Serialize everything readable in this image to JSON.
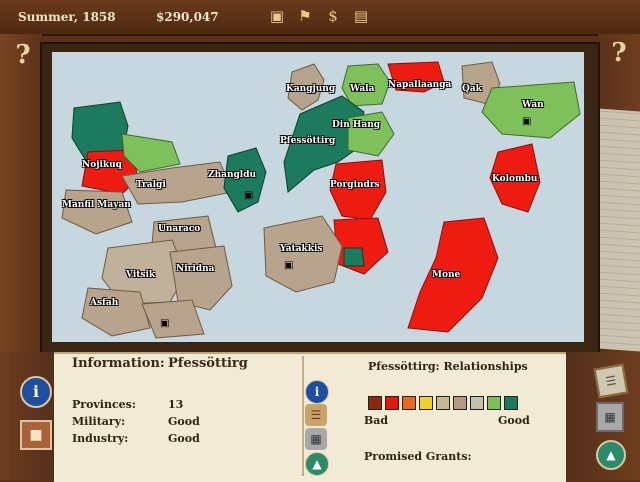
{
  "header": {
    "season": "Summer, 1858",
    "money": "$290,047"
  },
  "toolbar_icons": [
    "advisor-icon",
    "parliament-icon",
    "finance-icon",
    "factory-icon"
  ],
  "corners": {
    "left": "?",
    "right": "?"
  },
  "map": {
    "provinces": [
      {
        "name": "Kangjung"
      },
      {
        "name": "Wala"
      },
      {
        "name": "Napallaanga"
      },
      {
        "name": "Qak"
      },
      {
        "name": "Wan"
      },
      {
        "name": "Pfessöttirg"
      },
      {
        "name": "Din Hang"
      },
      {
        "name": "Nojikuq"
      },
      {
        "name": "Tralgi"
      },
      {
        "name": "Zhangldu"
      },
      {
        "name": "Porgindrs"
      },
      {
        "name": "Kolombu"
      },
      {
        "name": "Manfil Mayan"
      },
      {
        "name": "Unaraco"
      },
      {
        "name": "Yatakkis"
      },
      {
        "name": "Vitsik"
      },
      {
        "name": "Niridna"
      },
      {
        "name": "Mone"
      },
      {
        "name": "Asfah"
      }
    ]
  },
  "info": {
    "title": "Information:",
    "name": "Pfessöttirg",
    "rows": [
      {
        "label": "Provinces:",
        "value": "13"
      },
      {
        "label": "Military:",
        "value": "Good"
      },
      {
        "label": "Industry:",
        "value": "Good"
      }
    ]
  },
  "relationships": {
    "title": "Pfessöttirg: Relationships",
    "scale_colors": [
      "#8b2a0a",
      "#e21a0e",
      "#e86a18",
      "#f0d22a",
      "#c8b890",
      "#b39a80",
      "#c4c0ae",
      "#7fbf58",
      "#1a7a5a"
    ],
    "bad_label": "Bad",
    "good_label": "Good",
    "grants_label": "Promised Grants:"
  },
  "colors": {
    "sea": "#c6d7df",
    "enemy": "#ee1c10",
    "ally": "#1b7b5c",
    "friend": "#7ec05a",
    "neutral": "#b8a48c"
  }
}
